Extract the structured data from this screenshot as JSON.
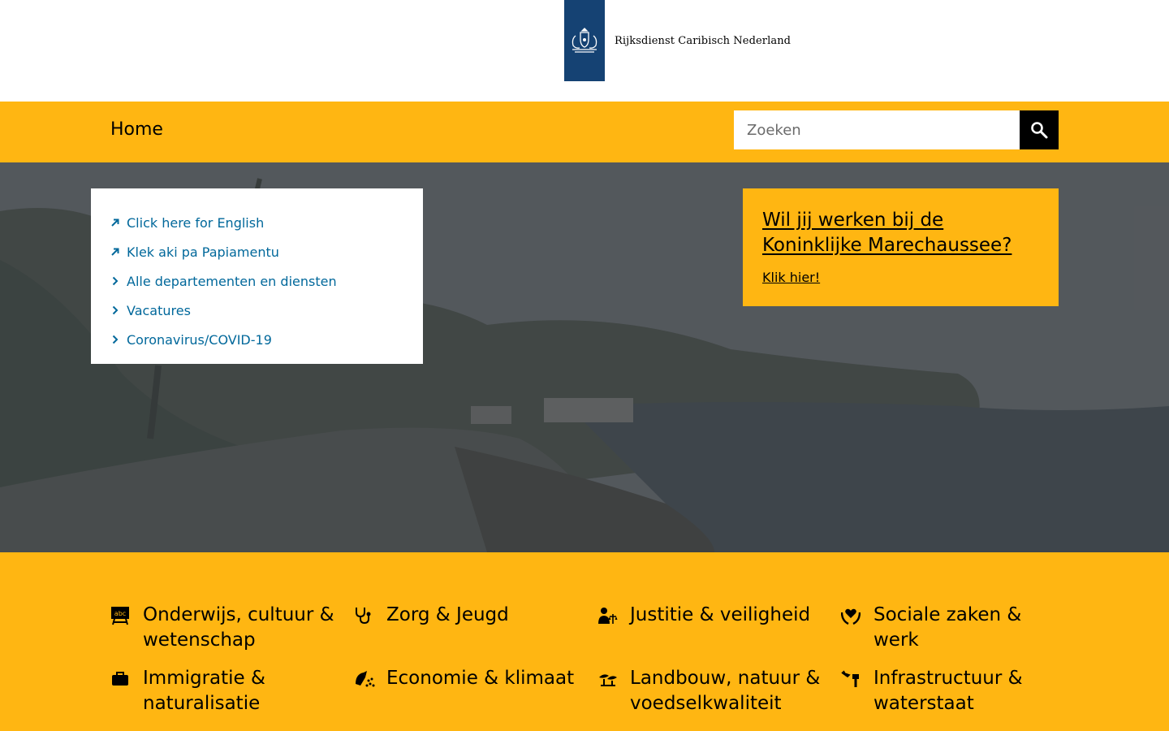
{
  "header": {
    "logo_text": "Rijksdienst Caribisch Nederland"
  },
  "nav": {
    "home_label": "Home",
    "search_placeholder": "Zoeken"
  },
  "quicklinks": [
    {
      "label": "Click here for English",
      "icon": "external-arrow-icon"
    },
    {
      "label": "Klek aki pa Papiamentu",
      "icon": "external-arrow-icon"
    },
    {
      "label": "Alle departementen en diensten",
      "icon": "chevron-right-icon"
    },
    {
      "label": "Vacatures",
      "icon": "chevron-right-icon"
    },
    {
      "label": "Coronavirus/COVID-19",
      "icon": "chevron-right-icon"
    }
  ],
  "promo": {
    "title": "Wil jij werken bij de Koninklijke Marechaussee?",
    "link": "Klik hier!"
  },
  "topics": [
    {
      "label": "Onderwijs, cultuur & wetenschap",
      "icon": "school-board-icon"
    },
    {
      "label": "Zorg & Jeugd",
      "icon": "stethoscope-icon"
    },
    {
      "label": "Justitie & veiligheid",
      "icon": "justice-icon"
    },
    {
      "label": "Sociale zaken & werk",
      "icon": "heart-hands-icon"
    },
    {
      "label": "Immigratie & naturalisatie",
      "icon": "briefcase-icon"
    },
    {
      "label": "Economie & klimaat",
      "icon": "economy-icon"
    },
    {
      "label": "Landbouw, natuur & voedselkwaliteit",
      "icon": "agriculture-icon"
    },
    {
      "label": "Infrastructuur & waterstaat",
      "icon": "infrastructure-icon"
    }
  ],
  "colors": {
    "brand_blue": "#154273",
    "accent_yellow": "#ffb612",
    "link_blue": "#01689b"
  }
}
